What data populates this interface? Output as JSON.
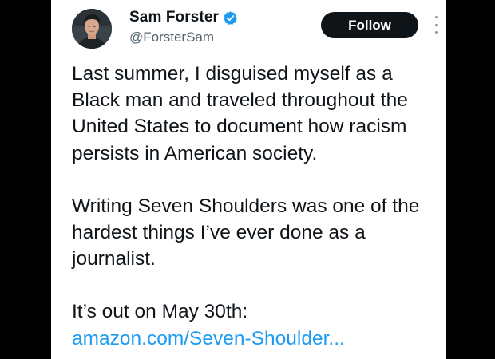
{
  "tweet": {
    "author": {
      "display_name": "Sam Forster",
      "handle": "@ForsterSam",
      "verified": true
    },
    "follow_label": "Follow",
    "paragraphs": [
      "Last summer, I disguised myself as a Black man and traveled throughout the United States to document how racism persists in American society.",
      "Writing Seven Shoulders was one of the hardest things I’ve ever done as a journalist."
    ],
    "release_text": "It’s out on May 30th:",
    "link_text": "amazon.com/Seven-Shoulder..."
  },
  "colors": {
    "background": "#000000",
    "card": "#ffffff",
    "text": "#0f1419",
    "secondary_text": "#536471",
    "link": "#1d9bf0",
    "verified_badge": "#1d9bf0",
    "follow_button_bg": "#0f1419",
    "follow_button_text": "#ffffff"
  },
  "icons": {
    "verified": "verified-badge-icon",
    "more": "more-vertical-icon"
  }
}
